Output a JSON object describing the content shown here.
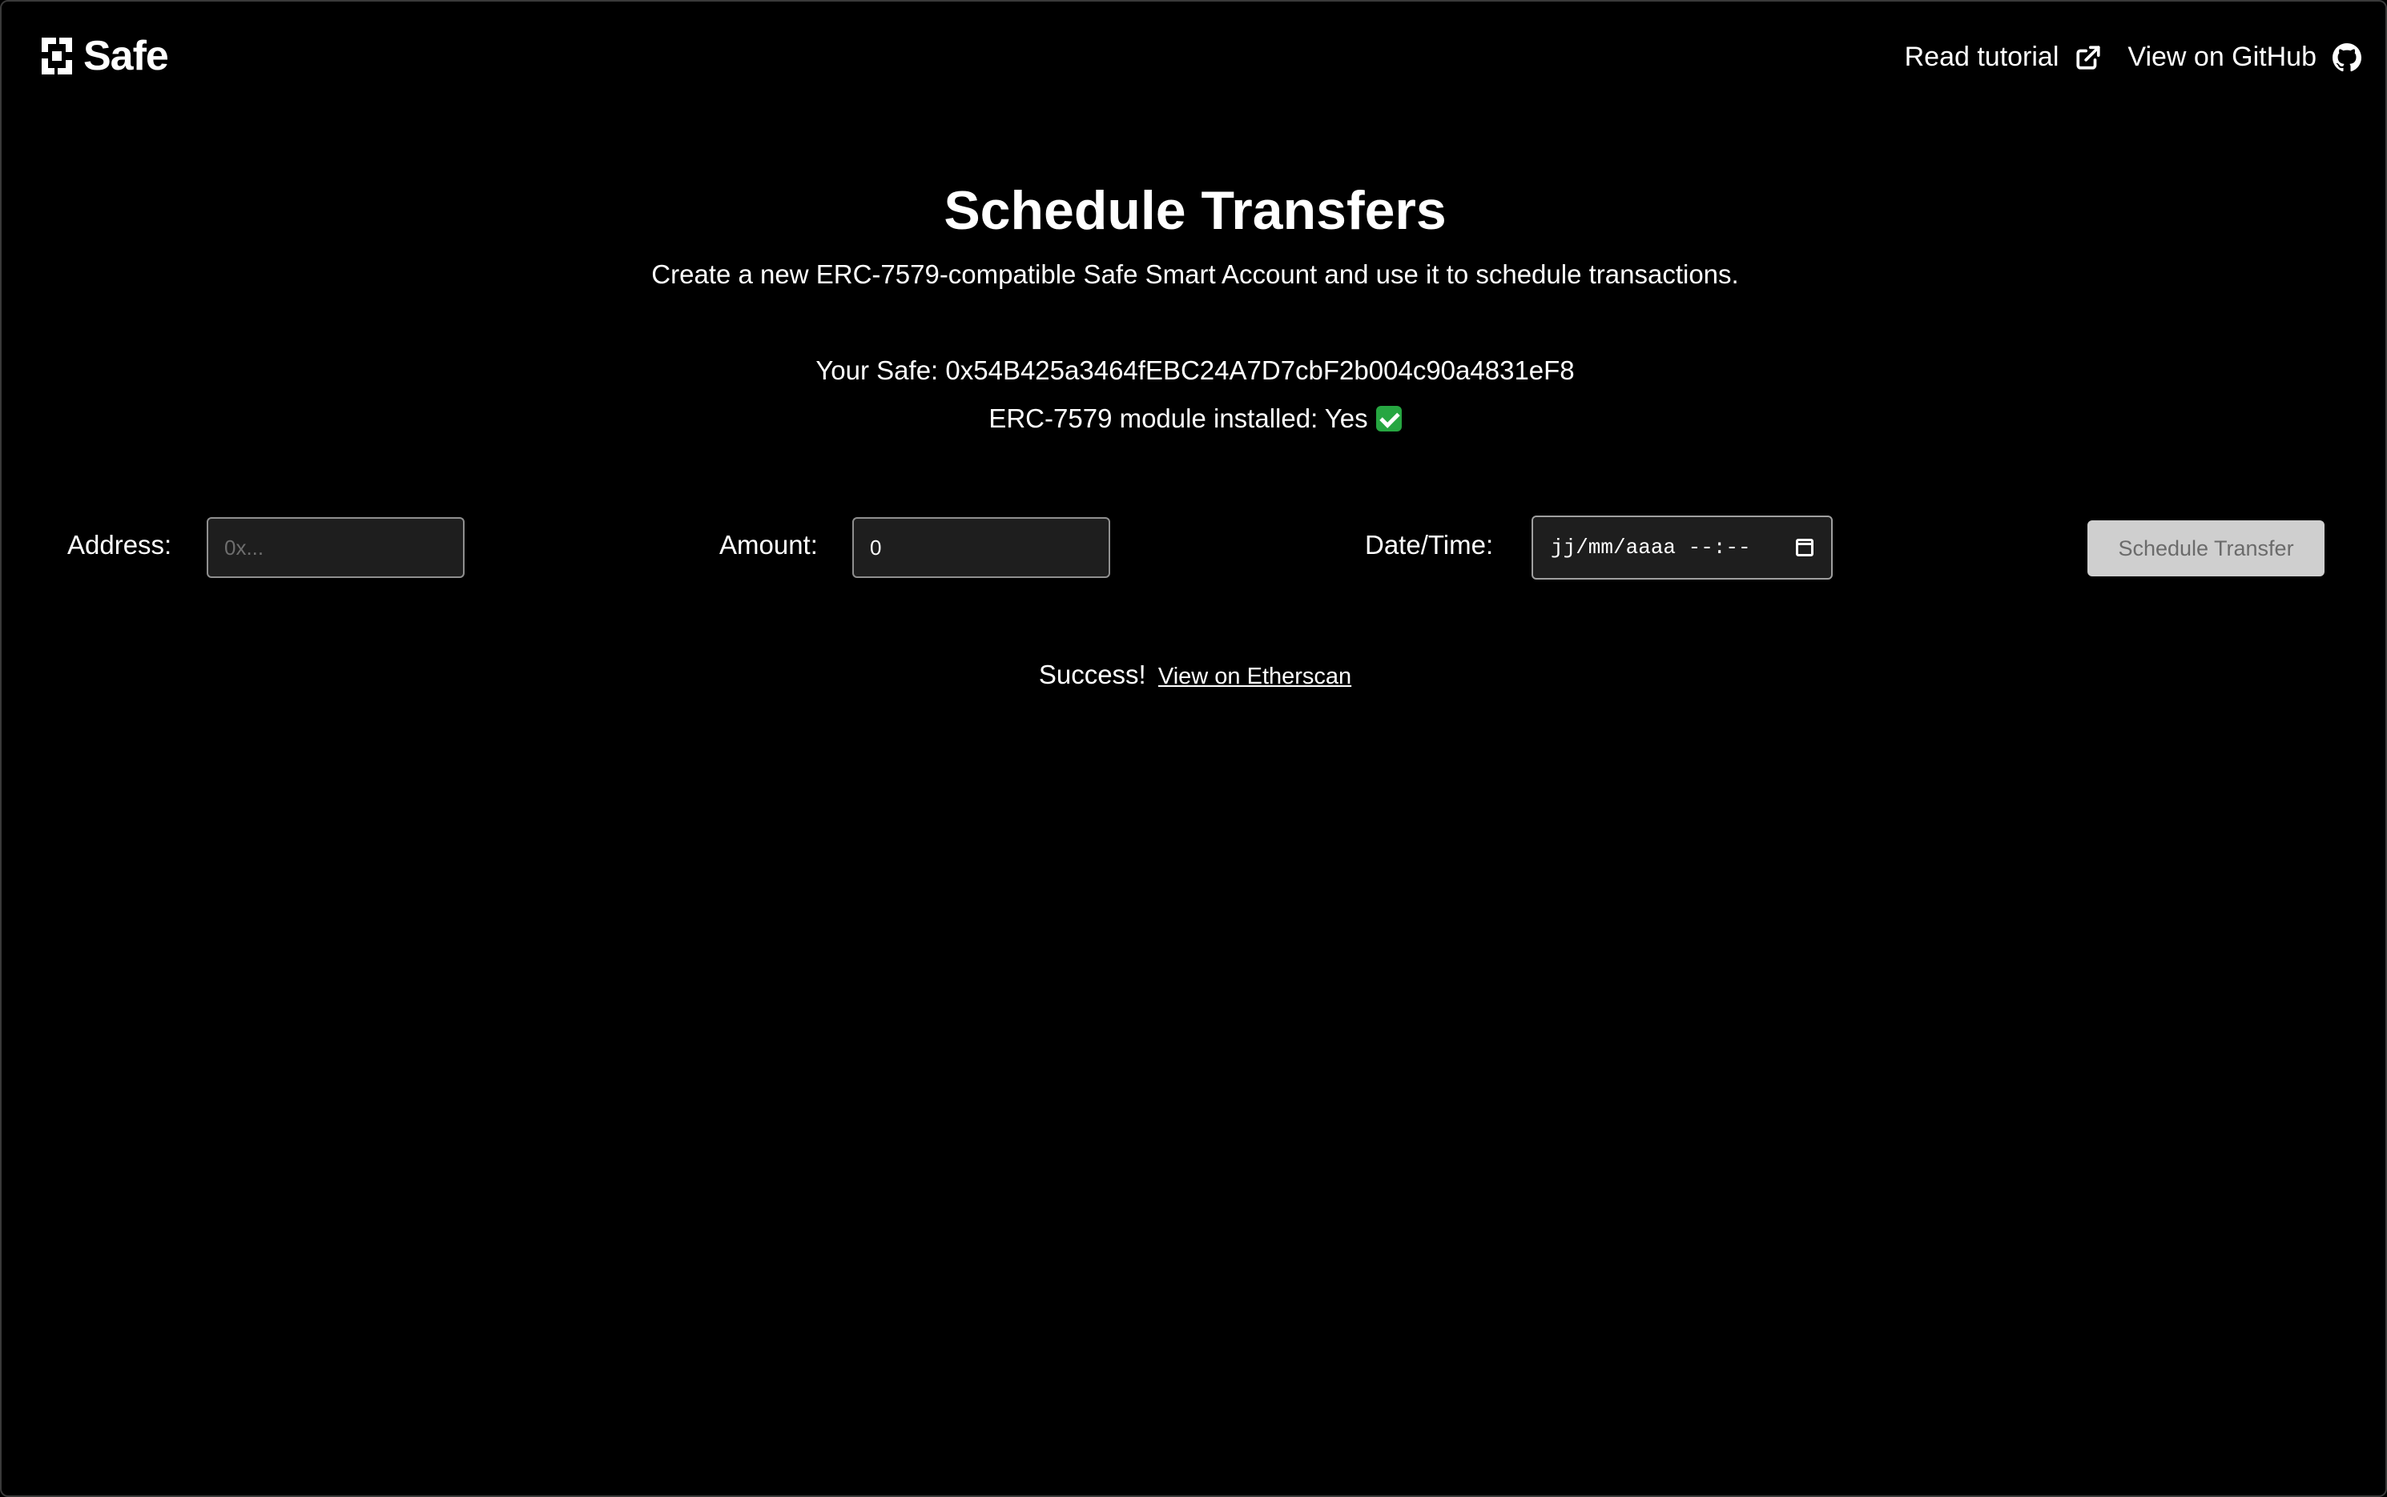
{
  "header": {
    "logo_text": "Safe",
    "nav": {
      "tutorial_label": "Read tutorial",
      "github_label": "View on GitHub"
    }
  },
  "main": {
    "title": "Schedule Transfers",
    "subtitle": "Create a new ERC-7579-compatible Safe Smart Account and use it to schedule transactions.",
    "safe_label": "Your Safe: 0x54B425a3464fEBC24A7D7cbF2b004c90a4831eF8",
    "module_label": "ERC-7579 module installed: Yes"
  },
  "form": {
    "address_label": "Address:",
    "address_placeholder": "0x...",
    "amount_label": "Amount:",
    "amount_value": "0",
    "datetime_label": "Date/Time:",
    "datetime_placeholder": "jj/mm/aaaa --:--",
    "submit_label": "Schedule Transfer"
  },
  "status": {
    "success_text": "Success!",
    "etherscan_link": "View on Etherscan"
  },
  "colors": {
    "background": "#000000",
    "text": "#ffffff",
    "button_bg": "#cfcfcf",
    "check": "#26a641"
  },
  "icons": [
    "safe-logo-icon",
    "external-link-icon",
    "github-icon",
    "check-mark-icon",
    "calendar-icon"
  ]
}
